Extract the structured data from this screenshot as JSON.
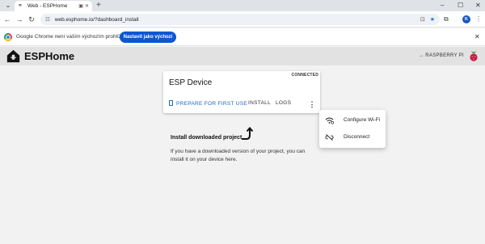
{
  "browser": {
    "tab_title": "Web - ESPHome",
    "url": "web.esphome.io/?dashboard_install",
    "profile_initial": "K",
    "new_tab_glyph": "+",
    "minimize_glyph": "–",
    "maximize_glyph": "☐",
    "close_glyph": "✕"
  },
  "infobar": {
    "message": "Google Chrome není vaším výchozím prohlížečem",
    "button_label": "Nastavit jako výchozí"
  },
  "app": {
    "title": "ESPHome",
    "host_label": "→ RASPBERRY PI"
  },
  "device_card": {
    "status": "CONNECTED",
    "name": "ESP Device",
    "actions": {
      "prepare": "PREPARE FOR FIRST USE",
      "install": "INSTALL",
      "logs": "LOGS"
    }
  },
  "menu": {
    "items": [
      {
        "label": "Configure Wi-Fi",
        "icon": "wifi-settings-icon"
      },
      {
        "label": "Disconnect",
        "icon": "link-off-icon"
      }
    ]
  },
  "install_section": {
    "title": "Install downloaded project",
    "text": "If you have a downloaded version of your project, you can install it on your device here."
  },
  "colors": {
    "accent": "#1565c0",
    "chrome_button": "#0b57d0",
    "header_bg": "#e2e2e2",
    "page_bg": "#f2f2f2"
  }
}
